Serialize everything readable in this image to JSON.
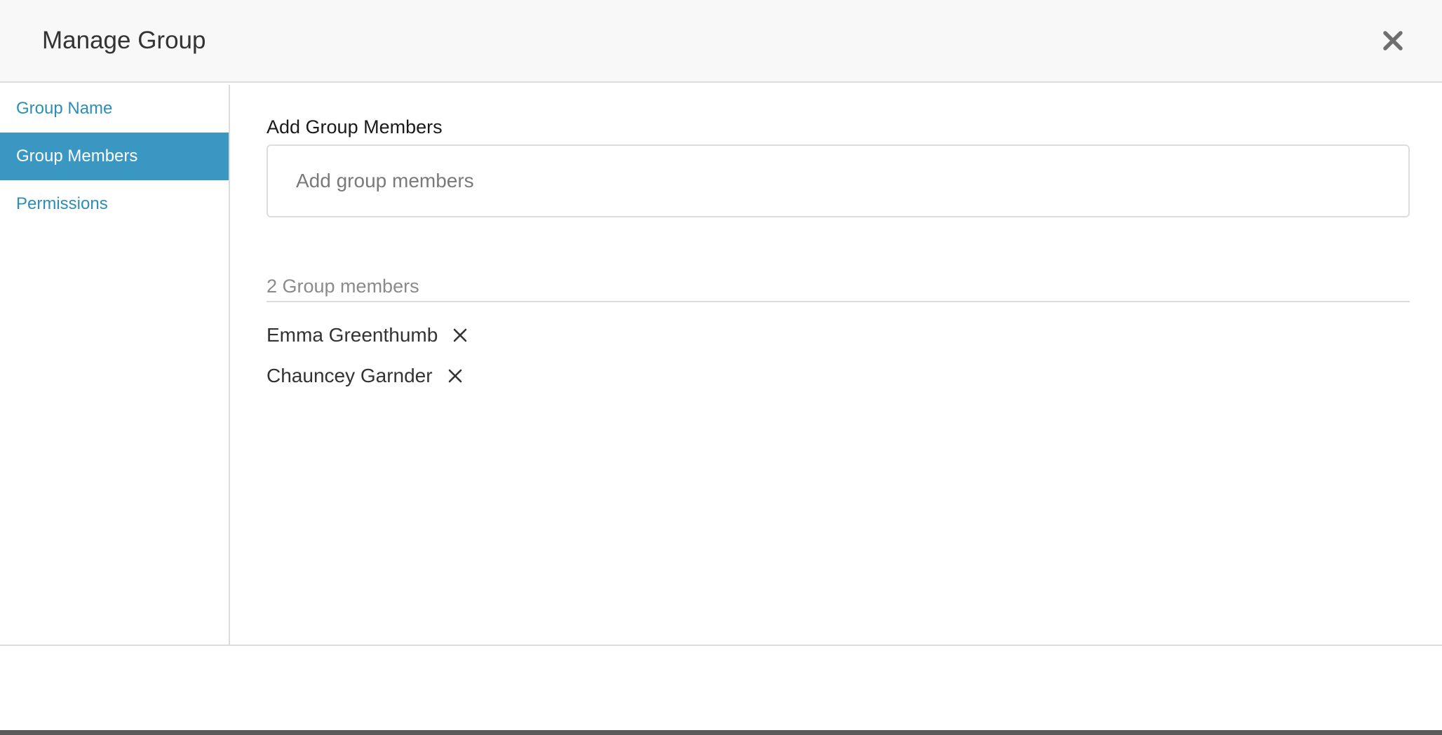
{
  "header": {
    "title": "Manage Group",
    "close_icon": "close-icon"
  },
  "sidebar": {
    "items": [
      {
        "label": "Group Name",
        "active": false
      },
      {
        "label": "Group Members",
        "active": true
      },
      {
        "label": "Permissions",
        "active": false
      }
    ]
  },
  "main": {
    "section_title": "Add Group Members",
    "input": {
      "placeholder": "Add group members",
      "value": ""
    },
    "members_count_label": "2 Group members",
    "members": [
      {
        "name": "Emma Greenthumb",
        "remove_icon": "remove-icon"
      },
      {
        "name": "Chauncey Garnder",
        "remove_icon": "remove-icon"
      }
    ]
  },
  "colors": {
    "accent": "#3a97c2",
    "link": "#2b8fb5",
    "header_bg": "#f8f8f8",
    "border": "#dcdcdc"
  }
}
